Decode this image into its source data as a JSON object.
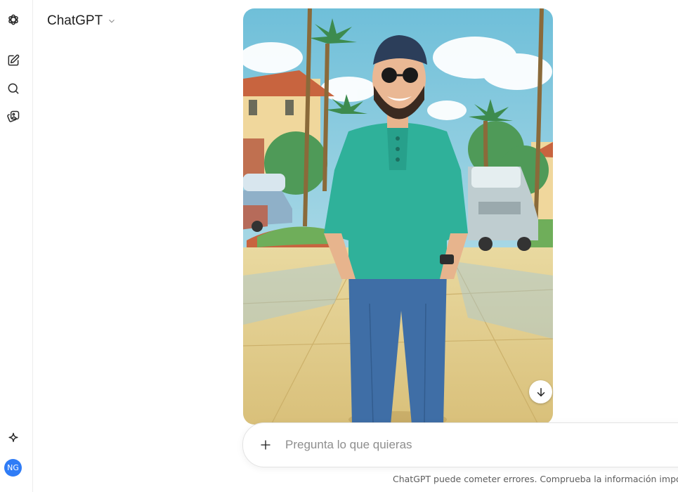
{
  "app": {
    "model_title": "ChatGPT"
  },
  "sidebar": {
    "items": [
      {
        "name": "openai-logo-icon"
      },
      {
        "name": "new-chat-icon"
      },
      {
        "name": "search-icon"
      },
      {
        "name": "library-icon"
      }
    ],
    "bottom": {
      "sparkle_icon": "sparkle-icon",
      "avatar_initials": "NG"
    }
  },
  "conversation": {
    "image_alt": "Generated illustration",
    "download_icon": "download-arrow-icon"
  },
  "composer": {
    "placeholder": "Pregunta lo que quieras",
    "plus_icon": "plus-icon"
  },
  "footer": {
    "disclaimer": "ChatGPT puede cometer errores. Comprueba la información importan"
  },
  "colors": {
    "avatar_bg": "#2f7cf6",
    "shirt": "#2fb19a",
    "jeans": "#3f6ea6",
    "sky": "#8fcde3"
  }
}
